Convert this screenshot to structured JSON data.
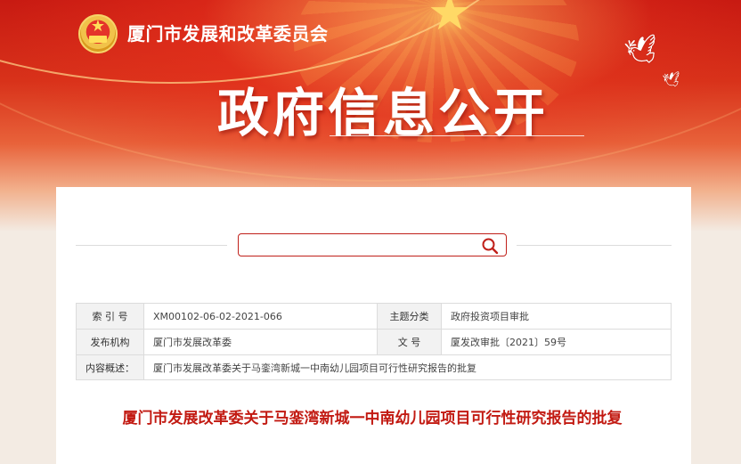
{
  "header": {
    "org_name": "厦门市发展和改革委员会",
    "page_title": "政府信息公开",
    "emblem_icon": "national-emblem-icon",
    "dove_icon": "dove-icon"
  },
  "search": {
    "value": "",
    "placeholder": "",
    "icon": "search-icon",
    "accent_color": "#c0201a"
  },
  "info_table": {
    "index_label": "索 引 号",
    "index_value": "XM00102-06-02-2021-066",
    "topic_label": "主题分类",
    "topic_value": "政府投资项目审批",
    "publisher_label": "发布机构",
    "publisher_value": "厦门市发展改革委",
    "doc_no_label": "文    号",
    "doc_no_value": "厦发改审批〔2021〕59号",
    "summary_label": "内容概述：",
    "summary_value": "厦门市发展改革委关于马銮湾新城一中南幼儿园项目可行性研究报告的批复"
  },
  "document": {
    "title": "厦门市发展改革委关于马銮湾新城一中南幼儿园项目可行性研究报告的批复",
    "title_color": "#c21a12"
  },
  "colors": {
    "banner_red": "#c81a12",
    "accent": "#c0201a"
  }
}
